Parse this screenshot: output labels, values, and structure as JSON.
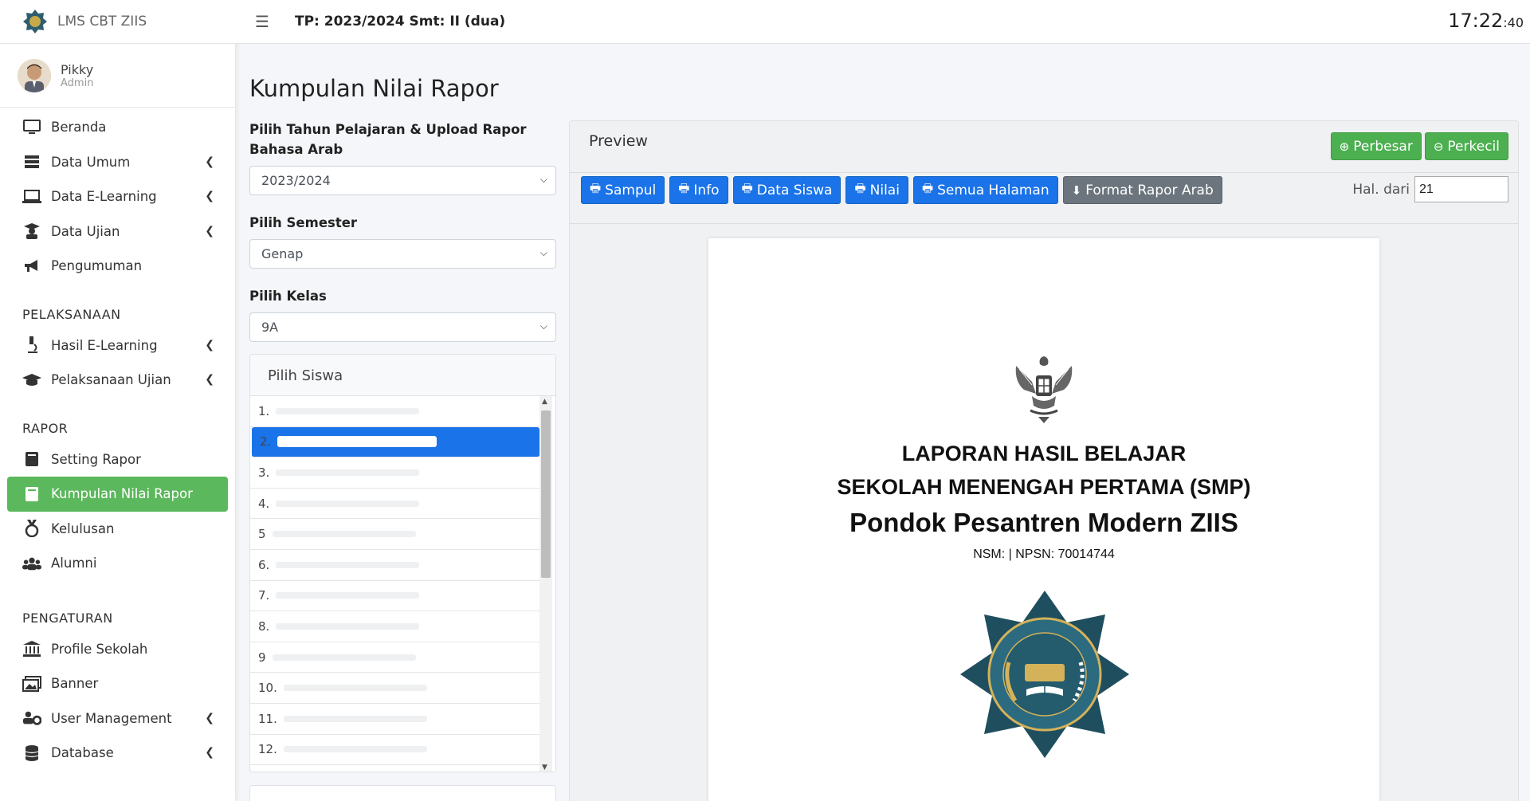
{
  "brand": {
    "name": "LMS CBT ZIIS"
  },
  "user": {
    "name": "Pikky",
    "role": "Admin"
  },
  "sidebar": {
    "main": [
      {
        "label": "Beranda",
        "icon": "monitor-icon",
        "has_children": false
      },
      {
        "label": "Data Umum",
        "icon": "server-icon",
        "has_children": true
      },
      {
        "label": "Data E-Learning",
        "icon": "laptop-icon",
        "has_children": true
      },
      {
        "label": "Data Ujian",
        "icon": "user-graduate-icon",
        "has_children": true
      },
      {
        "label": "Pengumuman",
        "icon": "bullhorn-icon",
        "has_children": false
      }
    ],
    "pelaksanaan_header": "PELAKSANAAN",
    "pelaksanaan": [
      {
        "label": "Hasil E-Learning",
        "icon": "microscope-icon",
        "has_children": true
      },
      {
        "label": "Pelaksanaan Ujian",
        "icon": "graduation-cap-icon",
        "has_children": true
      }
    ],
    "rapor_header": "RAPOR",
    "rapor": [
      {
        "label": "Setting Rapor",
        "icon": "book-icon",
        "has_children": false
      },
      {
        "label": "Kumpulan Nilai Rapor",
        "icon": "book-icon",
        "has_children": false,
        "active": true
      },
      {
        "label": "Kelulusan",
        "icon": "medal-icon",
        "has_children": false
      },
      {
        "label": "Alumni",
        "icon": "users-icon",
        "has_children": false
      }
    ],
    "pengaturan_header": "PENGATURAN",
    "pengaturan": [
      {
        "label": "Profile Sekolah",
        "icon": "university-icon",
        "has_children": false
      },
      {
        "label": "Banner",
        "icon": "images-icon",
        "has_children": false
      },
      {
        "label": "User Management",
        "icon": "users-cog-icon",
        "has_children": true
      },
      {
        "label": "Database",
        "icon": "database-icon",
        "has_children": true
      }
    ]
  },
  "topbar": {
    "tp_text": "TP: 2023/2024 Smt: II (dua)",
    "clock_hm": "17:22",
    "clock_s": ":40"
  },
  "page": {
    "title": "Kumpulan Nilai Rapor"
  },
  "form": {
    "tahun_label": "Pilih Tahun Pelajaran & Upload Rapor Bahasa Arab",
    "tahun_value": "2023/2024",
    "semester_label": "Pilih Semester",
    "semester_value": "Genap",
    "kelas_label": "Pilih Kelas",
    "kelas_value": "9A"
  },
  "siswa": {
    "header": "Pilih Siswa",
    "items": [
      "1.",
      "2.",
      "3.",
      "4.",
      "5",
      "6.",
      "7.",
      "8.",
      "9",
      "10.",
      "11.",
      "12."
    ],
    "selected_index": 1
  },
  "preview": {
    "title": "Preview",
    "btn_perbesar": "Perbesar",
    "btn_perkecil": "Perkecil",
    "btn_sampul": "Sampul",
    "btn_info": "Info",
    "btn_data_siswa": "Data Siswa",
    "btn_nilai": "Nilai",
    "btn_semua": "Semua Halaman",
    "btn_format": "Format Rapor Arab",
    "hal_label": "Hal. dari",
    "hal_value": "21"
  },
  "report": {
    "title1": "LAPORAN HASIL BELAJAR",
    "title2": "SEKOLAH MENENGAH PERTAMA (SMP)",
    "school": "Pondok Pesantren Modern ZIIS",
    "nsm": "NSM: | NPSN: 70014744"
  },
  "colors": {
    "active_green": "#5cb85c",
    "primary_blue": "#1a73e8",
    "btn_green": "#4caf50",
    "btn_gray": "#6c757d"
  }
}
